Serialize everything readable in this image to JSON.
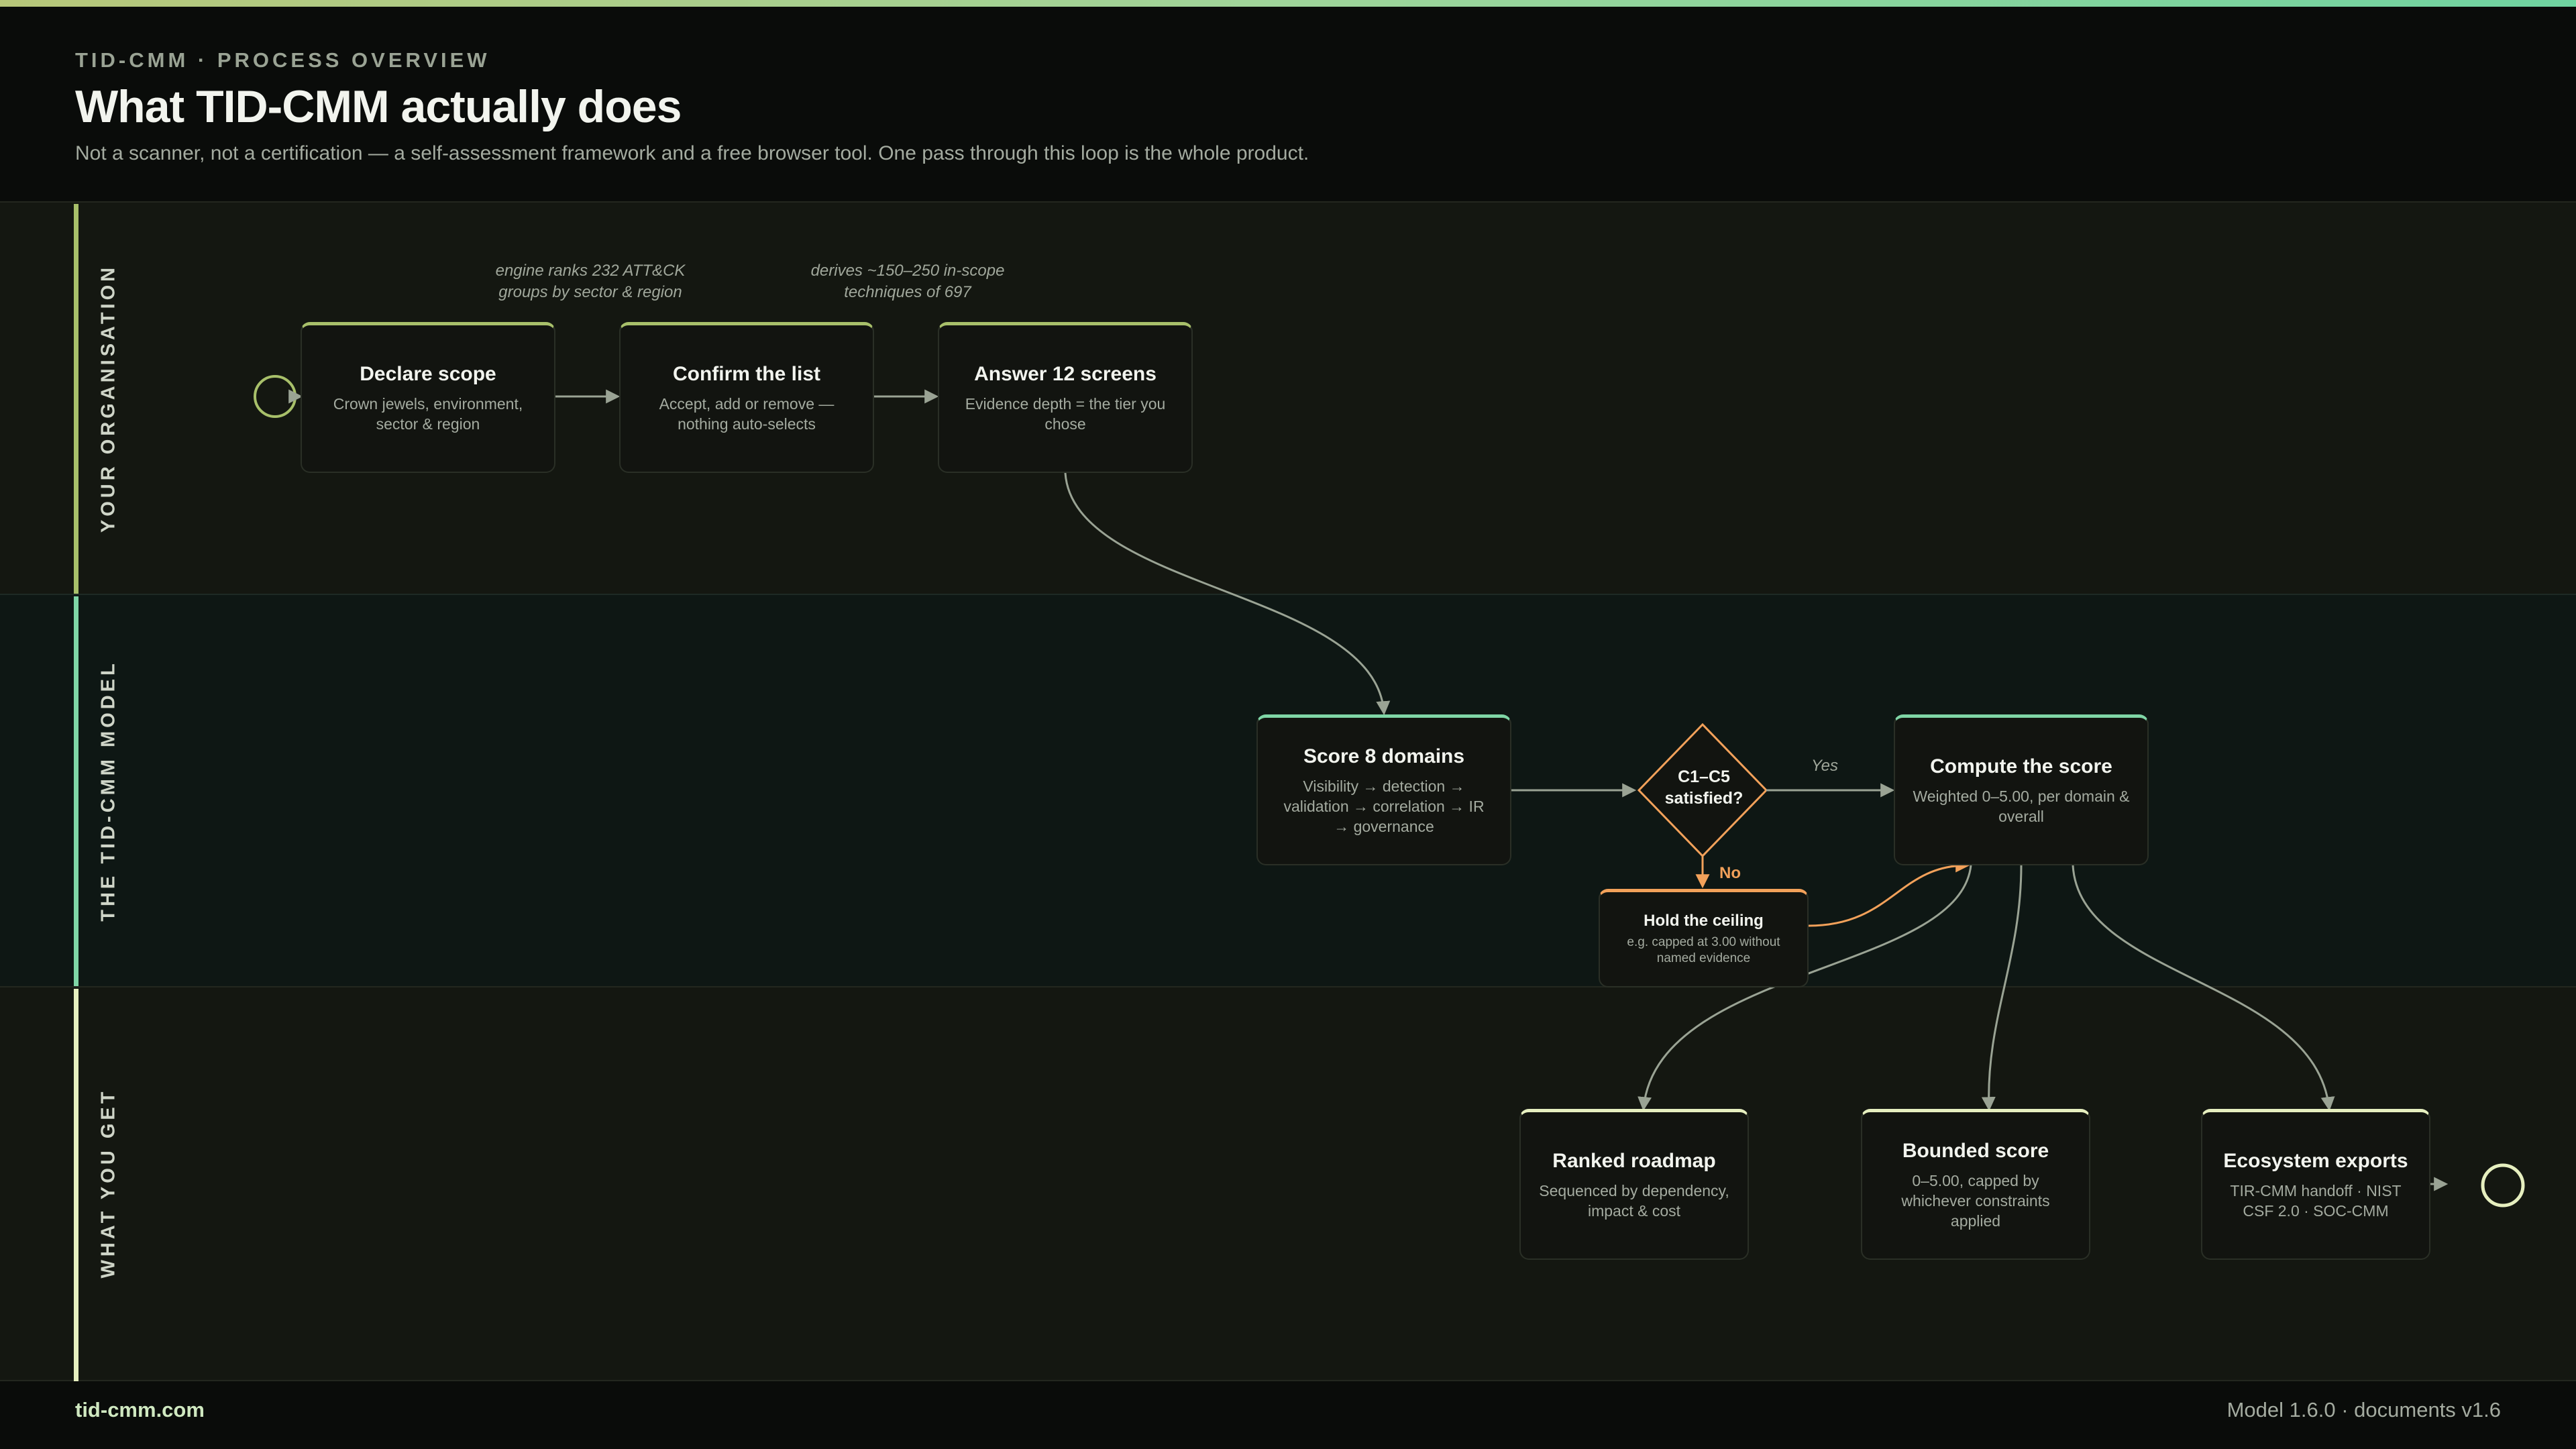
{
  "header": {
    "eyebrow": "TID-CMM · PROCESS OVERVIEW",
    "title": "What TID-CMM actually does",
    "subtitle": "Not a scanner, not a certification — a self-assessment framework and a free browser tool. One pass through this loop is the whole product."
  },
  "lanes": {
    "org": "YOUR ORGANISATION",
    "model": "THE TID-CMM MODEL",
    "get": "WHAT YOU GET"
  },
  "notes": {
    "engine": "engine ranks 232 ATT&CK groups by sector & region",
    "derives": "derives ~150–250 in-scope techniques of 697"
  },
  "nodes": {
    "declare": {
      "title": "Declare scope",
      "desc": "Crown jewels, environment, sector & region"
    },
    "confirm": {
      "title": "Confirm the list",
      "desc": "Accept, add or remove — nothing auto-selects"
    },
    "answer": {
      "title": "Answer 12 screens",
      "desc": "Evidence depth = the tier you chose"
    },
    "score8": {
      "title": "Score 8 domains",
      "desc": "Visibility → detection → validation → correlation → IR → governance"
    },
    "decision": "C1–C5 satisfied?",
    "ceiling": {
      "title": "Hold the ceiling",
      "desc": "e.g. capped at 3.00 without named evidence"
    },
    "compute": {
      "title": "Compute the score",
      "desc": "Weighted 0–5.00, per domain & overall"
    },
    "roadmap": {
      "title": "Ranked roadmap",
      "desc": "Sequenced by dependency, impact & cost"
    },
    "bounded": {
      "title": "Bounded score",
      "desc": "0–5.00, capped by whichever constraints applied"
    },
    "exports": {
      "title": "Ecosystem exports",
      "desc": "TIR-CMM handoff · NIST CSF 2.0 · SOC-CMM"
    }
  },
  "edges": {
    "yes": "Yes",
    "no": "No"
  },
  "colors": {
    "olive": "#a8c06a",
    "teal": "#7fd6a6",
    "cream": "#e6efbf",
    "orange": "#f2a15a",
    "connector": "#9aa394"
  },
  "footer": {
    "site": "tid-cmm.com",
    "version": "Model 1.6.0 · documents v1.6"
  }
}
